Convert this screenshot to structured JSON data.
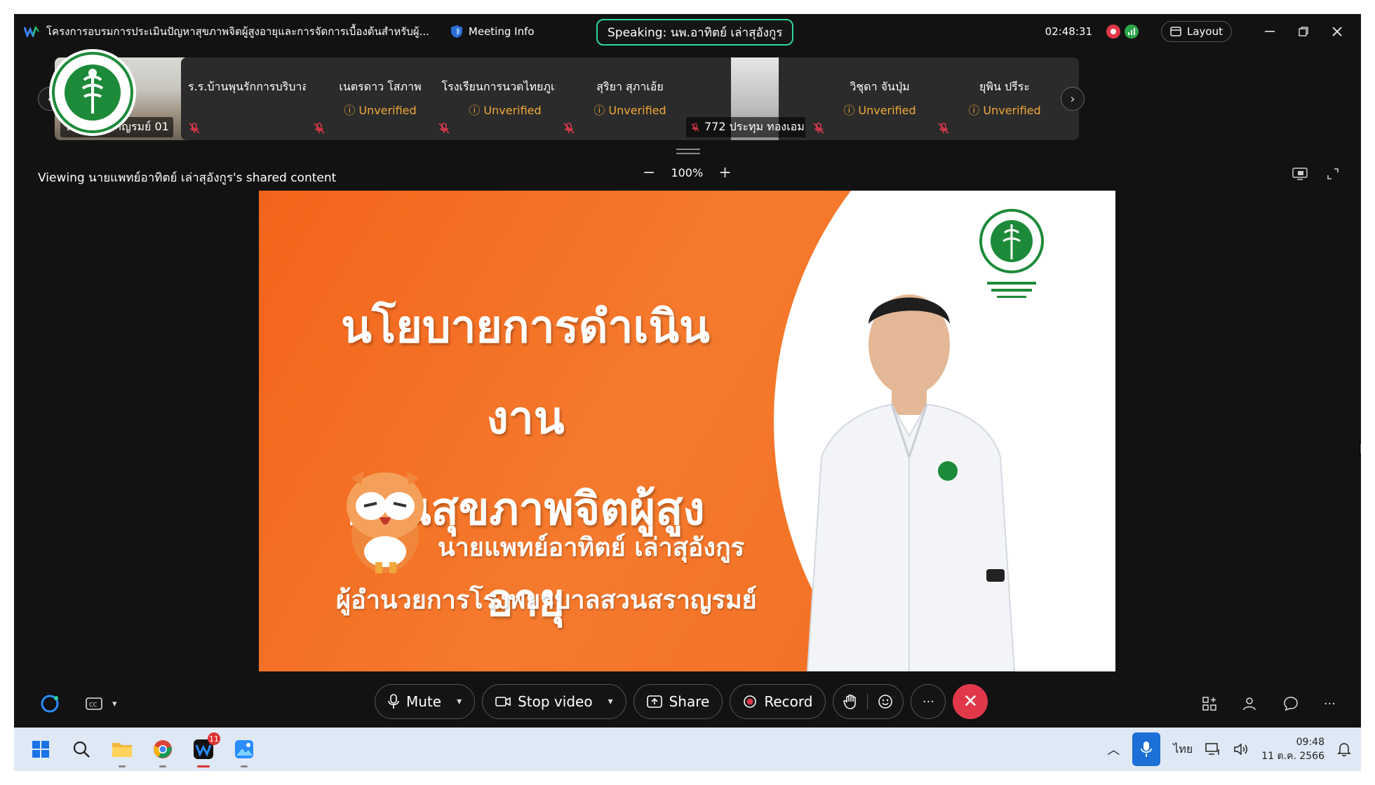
{
  "titlebar": {
    "meeting_title": "โครงการอบรมการประเมินปัญหาสุขภาพจิตผู้สูงอายุและการจัดการเบื้องต้นสำหรับผู้...",
    "meeting_info": "Meeting Info",
    "speaking": "Speaking: นพ.อาทิตย์ เล่าสุอังกูร",
    "timer": "02:48:31",
    "layout": "Layout"
  },
  "participants": [
    {
      "name": "รพ.สวนสราญรมย์ 01",
      "status": ""
    },
    {
      "name": "ร.ร.บ้านพุนรักการบริบาล ...",
      "status": ""
    },
    {
      "name": "เนตรดาว โสภาพ",
      "status": "Unverified"
    },
    {
      "name": "โรงเรียนการนวดไทยภูเก็ต",
      "status": "Unverified"
    },
    {
      "name": "สุริยา สุภาเอ้ย",
      "status": "Unverified"
    },
    {
      "name": "772 ประทุม ทองเอม",
      "status": ""
    },
    {
      "name": "วิชุดา จันปุ่ม",
      "status": "Unverified"
    },
    {
      "name": "ยุพิน ปรีระ",
      "status": "Unverified"
    }
  ],
  "share": {
    "viewing": "Viewing นายแพทย์อาทิตย์ เล่าสุอังกูร's shared content",
    "zoom": "100%",
    "zoom_out": "−",
    "zoom_in": "+"
  },
  "slide": {
    "title_line1": "นโยบายการดำเนินงาน",
    "title_line2": "ด้านสุขภาพจิตผู้สูงอายุ",
    "presenter": "นายแพทย์อาทิตย์  เล่าสุอังกูร",
    "position": "ผู้อำนวยการโรงพยาบาลสวนสราญรมย์"
  },
  "controls": {
    "mute": "Mute",
    "stop_video": "Stop video",
    "share": "Share",
    "record": "Record",
    "more": "···",
    "end": "✕"
  },
  "taskbar": {
    "badge": "11",
    "lang": "ไทย",
    "time": "09:48",
    "date": "11 ต.ค. 2566"
  },
  "colors": {
    "accent_speaking": "#2bd4a1",
    "end_call": "#e0384a",
    "unverified": "#f0a93a",
    "slide_orange": "#f3641b"
  }
}
